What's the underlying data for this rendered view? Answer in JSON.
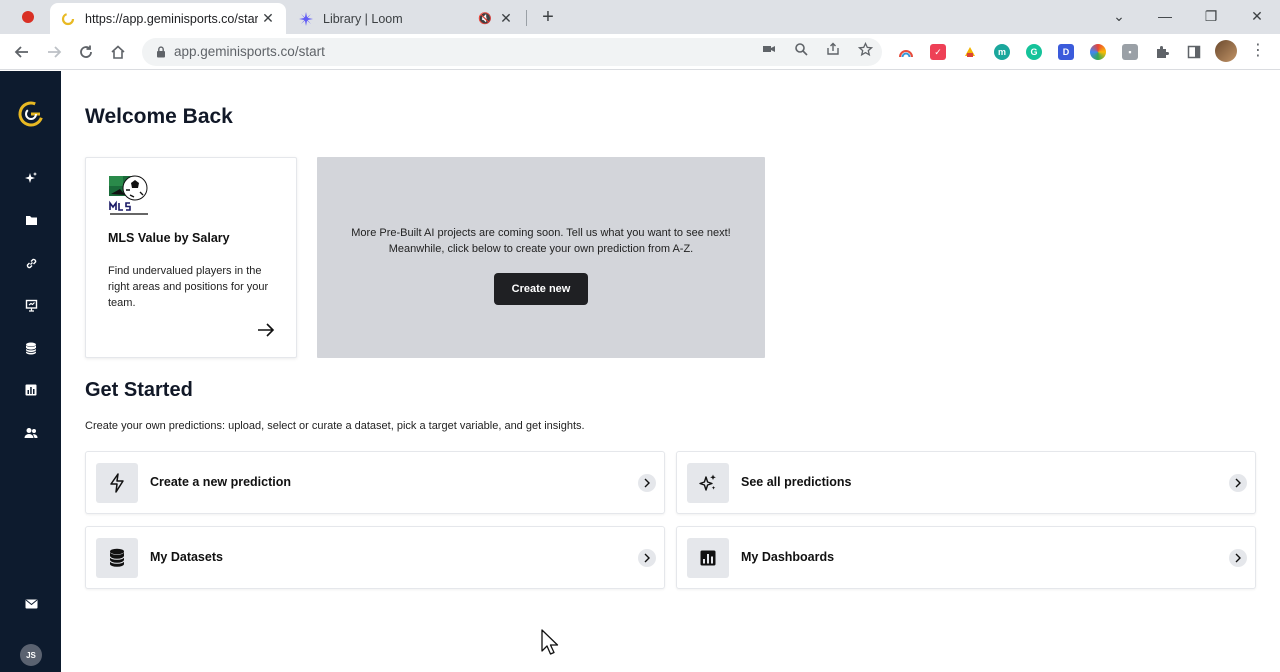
{
  "browser": {
    "tabs": [
      {
        "title": "https://app.geminisports.co/start",
        "active": true
      },
      {
        "title": "Library | Loom",
        "active": false
      }
    ],
    "url": "app.geminisports.co/start"
  },
  "app": {
    "brand_color": "#e8b923",
    "sidebar_bg": "#0d1b2e",
    "sidebar_icons": [
      "sparkle-icon",
      "folder-icon",
      "link-icon",
      "presentation-icon",
      "database-icon",
      "chart-icon",
      "users-icon"
    ],
    "user_initials": "JS"
  },
  "main": {
    "welcome_title": "Welcome Back",
    "mls_card": {
      "title": "MLS Value by Salary",
      "description": "Find undervalued players in the right areas and positions for your team."
    },
    "promo": {
      "message": "More Pre-Built AI projects are coming soon. Tell us what you want to see next! Meanwhile, click below to create your own prediction from A-Z.",
      "button": "Create new"
    },
    "get_started_title": "Get Started",
    "get_started_subtitle": "Create your own predictions: upload, select or curate a dataset, pick a target variable, and get insights.",
    "actions": [
      {
        "label": "Create a new prediction",
        "icon": "bolt-icon"
      },
      {
        "label": "See all predictions",
        "icon": "sparkle-icon"
      },
      {
        "label": "My Datasets",
        "icon": "database-icon"
      },
      {
        "label": "My Dashboards",
        "icon": "chart-icon"
      }
    ]
  }
}
